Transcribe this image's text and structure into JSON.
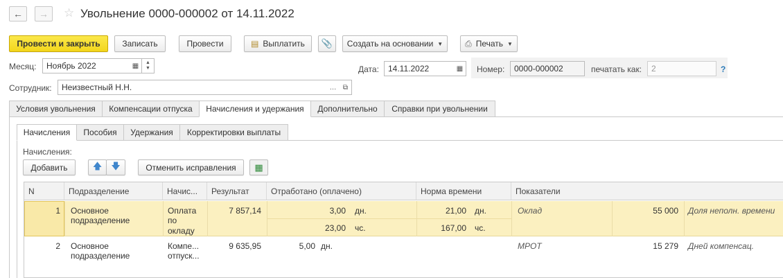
{
  "window": {
    "title": "Увольнение 0000-000002 от 14.11.2022"
  },
  "toolbar": {
    "post_close": "Провести и закрыть",
    "save": "Записать",
    "post": "Провести",
    "pay": "Выплатить",
    "create_based": "Создать на основании",
    "print": "Печать"
  },
  "form": {
    "month_label": "Месяц:",
    "month_value": "Ноябрь 2022",
    "date_label": "Дата:",
    "date_value": "14.11.2022",
    "number_label": "Номер:",
    "number_value": "0000-000002",
    "print_as_label": "печатать как:",
    "print_as_placeholder": "2",
    "help": "?",
    "employee_label": "Сотрудник:",
    "employee_value": "Неизвестный Н.Н."
  },
  "tabs": [
    "Условия увольнения",
    "Компенсации отпуска",
    "Начисления и удержания",
    "Дополнительно",
    "Справки при увольнении"
  ],
  "subtabs": [
    "Начисления",
    "Пособия",
    "Удержания",
    "Корректировки выплаты"
  ],
  "section": {
    "label": "Начисления:",
    "add": "Добавить",
    "cancel_fixes": "Отменить исправления"
  },
  "table": {
    "headers": {
      "n": "N",
      "dept": "Подразделение",
      "accrual": "Начис...",
      "result": "Результат",
      "worked": "Отработано (оплачено)",
      "norm": "Норма времени",
      "indicators": "Показатели"
    },
    "rows": [
      {
        "n": "1",
        "dept_line1": "Основное",
        "dept_line2": "подразделение",
        "acc_line1": "Оплата",
        "acc_line2": "по",
        "acc_line3": "окладу",
        "result": "7 857,14",
        "worked_days": "3,00",
        "worked_days_unit": "дн.",
        "worked_hours": "23,00",
        "worked_hours_unit": "чс.",
        "norm_days": "21,00",
        "norm_days_unit": "дн.",
        "norm_hours": "167,00",
        "norm_hours_unit": "чс.",
        "ind_name": "Оклад",
        "ind_value": "55 000",
        "ind2_name": "Доля неполн. времени"
      },
      {
        "n": "2",
        "dept_line1": "Основное",
        "dept_line2": "подразделение",
        "acc_line1": "Компе...",
        "acc_line2": "отпуск...",
        "result": "9 635,95",
        "worked_days": "5,00",
        "worked_days_unit": "дн.",
        "ind_name": "МРОТ",
        "ind_value": "15 279",
        "ind2_name": "Дней компенсац."
      }
    ]
  },
  "colors": {
    "primary_button": "#f5d923",
    "selected_row": "#fbf0c0",
    "help": "#2a7ab8"
  }
}
